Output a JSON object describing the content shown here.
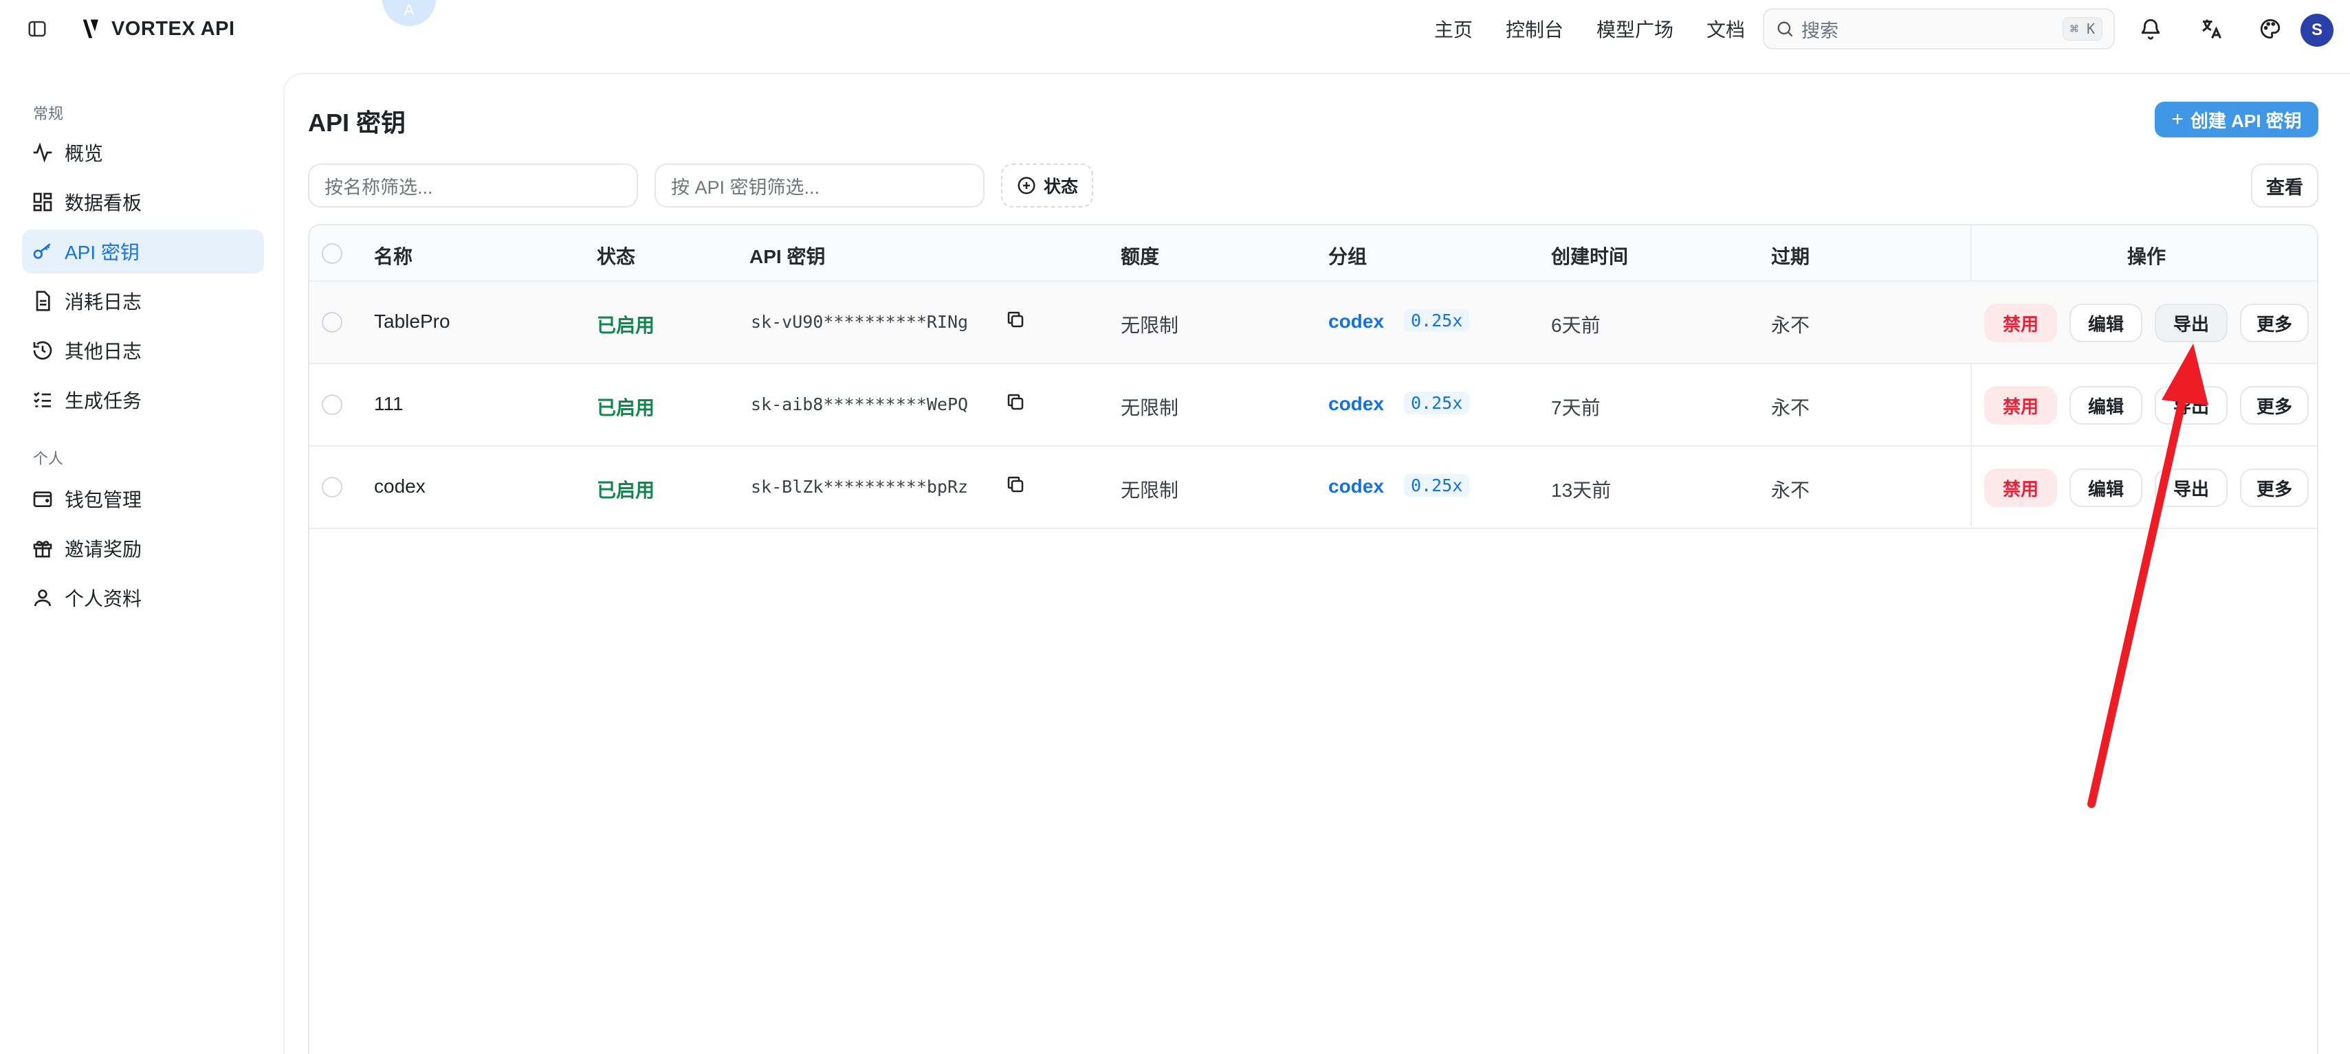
{
  "brand": {
    "name": "VORTEX API",
    "badge_text": "A"
  },
  "nav": [
    "主页",
    "控制台",
    "模型广场",
    "文档"
  ],
  "search": {
    "placeholder": "搜索",
    "shortcut": "⌘ K"
  },
  "user": {
    "initial": "S"
  },
  "sidebar": {
    "groups": [
      {
        "label": "常规",
        "items": [
          {
            "label": "概览",
            "icon": "activity-icon"
          },
          {
            "label": "数据看板",
            "icon": "dashboard-icon"
          },
          {
            "label": "API 密钥",
            "icon": "key-icon",
            "active": true
          },
          {
            "label": "消耗日志",
            "icon": "file-icon"
          },
          {
            "label": "其他日志",
            "icon": "history-icon"
          },
          {
            "label": "生成任务",
            "icon": "list-check-icon"
          }
        ]
      },
      {
        "label": "个人",
        "items": [
          {
            "label": "钱包管理",
            "icon": "wallet-icon"
          },
          {
            "label": "邀请奖励",
            "icon": "gift-icon"
          },
          {
            "label": "个人资料",
            "icon": "user-icon"
          }
        ]
      }
    ]
  },
  "page": {
    "title": "API 密钥",
    "create_label": "创建 API 密钥",
    "name_filter_placeholder": "按名称筛选...",
    "key_filter_placeholder": "按 API 密钥筛选...",
    "status_filter_label": "状态",
    "view_label": "查看"
  },
  "table": {
    "columns": [
      "名称",
      "状态",
      "API 密钥",
      "额度",
      "分组",
      "创建时间",
      "过期",
      "操作"
    ],
    "rows": [
      {
        "name": "TablePro",
        "status": "已启用",
        "key": "sk-vU90**********RINg",
        "quota": "无限制",
        "group": "codex",
        "ratio": "0.25x",
        "created": "6天前",
        "expires": "永不"
      },
      {
        "name": "111",
        "status": "已启用",
        "key": "sk-aib8**********WePQ",
        "quota": "无限制",
        "group": "codex",
        "ratio": "0.25x",
        "created": "7天前",
        "expires": "永不"
      },
      {
        "name": "codex",
        "status": "已启用",
        "key": "sk-BlZk**********bpRz",
        "quota": "无限制",
        "group": "codex",
        "ratio": "0.25x",
        "created": "13天前",
        "expires": "永不"
      }
    ],
    "actions": {
      "disable": "禁用",
      "edit": "编辑",
      "export": "导出",
      "more": "更多"
    }
  },
  "colors": {
    "accent": "#1672d4",
    "primary_button": "#3f97e6",
    "success": "#13864f",
    "danger": "#e0253b",
    "annotation_arrow": "#ee1c25"
  }
}
